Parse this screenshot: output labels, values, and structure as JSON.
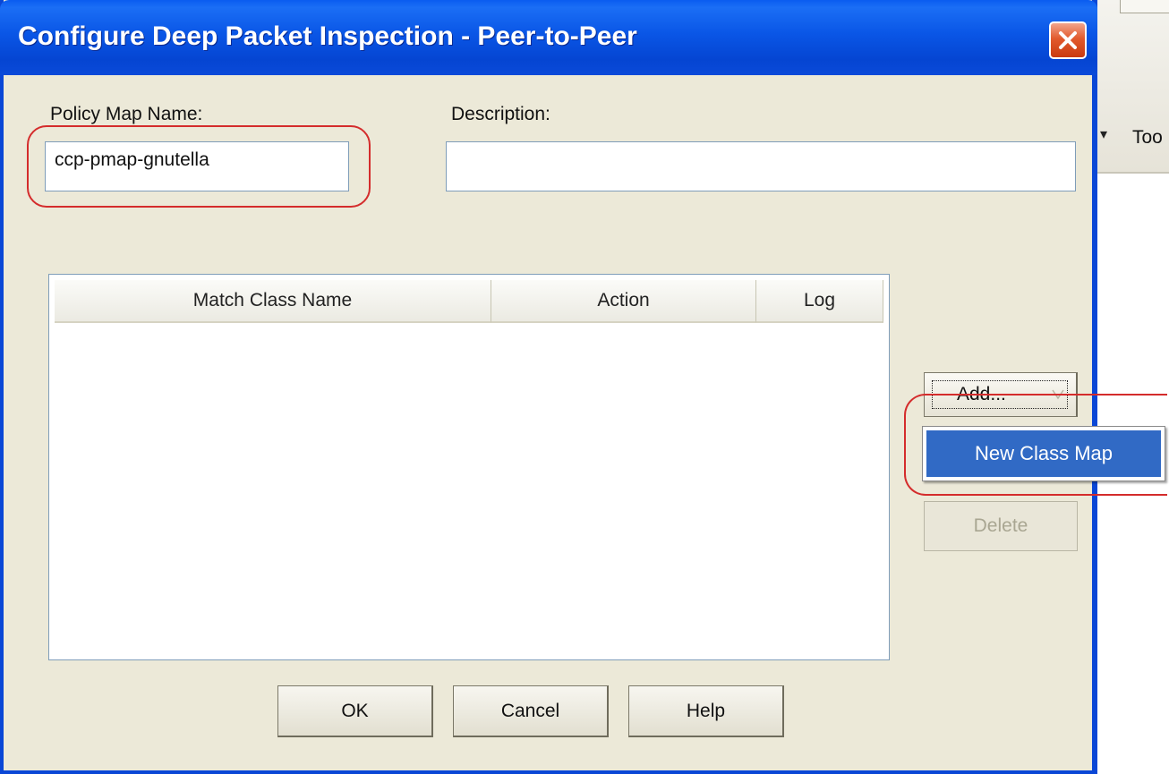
{
  "window": {
    "title": "Configure Deep Packet Inspection - Peer-to-Peer"
  },
  "background_app": {
    "toolbar_label": "Too"
  },
  "form": {
    "policy_map_label": "Policy Map Name:",
    "policy_map_value": "ccp-pmap-gnutella",
    "description_label": "Description:",
    "description_value": ""
  },
  "table": {
    "columns": [
      "Match Class Name",
      "Action",
      "Log"
    ],
    "rows": []
  },
  "side_buttons": {
    "add_label": "Add...",
    "delete_label": "Delete"
  },
  "add_menu": {
    "items": [
      "New Class Map"
    ]
  },
  "footer": {
    "ok_label": "OK",
    "cancel_label": "Cancel",
    "help_label": "Help"
  },
  "colors": {
    "titlebar": "#0a56e6",
    "dialog_bg": "#ece9d8",
    "menu_highlight": "#316ac5",
    "annotation": "#d42c2c"
  }
}
